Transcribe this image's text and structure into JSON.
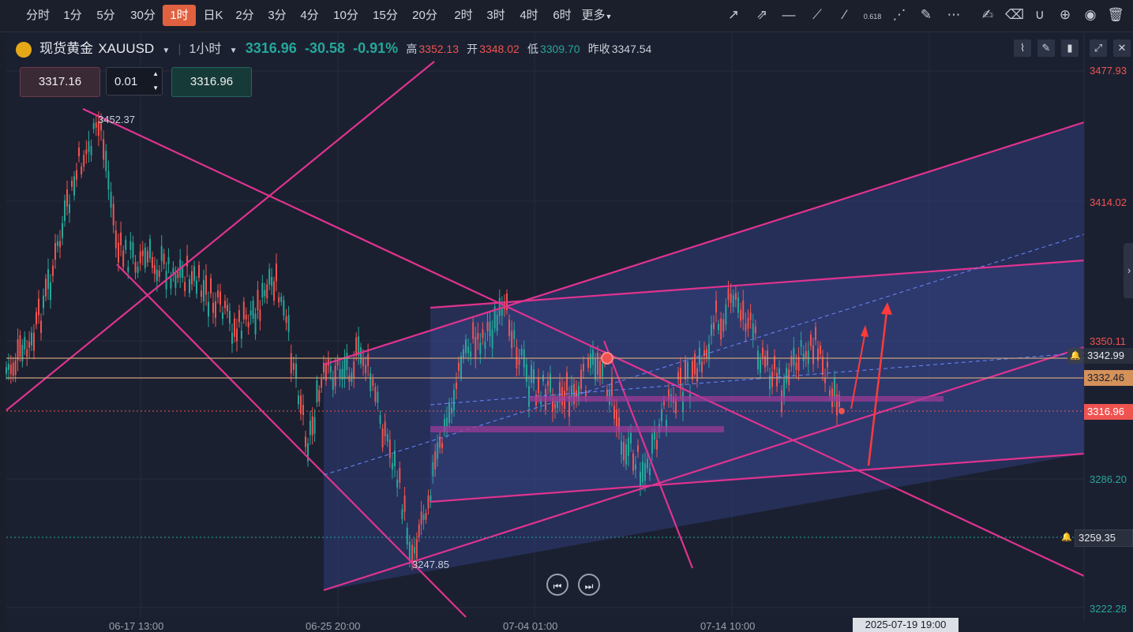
{
  "periods": [
    "分时",
    "1分",
    "5分",
    "30分",
    "1时",
    "日K",
    "2分",
    "3分",
    "4分",
    "10分",
    "15分",
    "20分",
    "2时",
    "3时",
    "4时",
    "6时",
    "更多"
  ],
  "active_period": "1时",
  "tools": [
    "arrow-line-icon",
    "dashed-arrow-icon",
    "horizontal-line-icon",
    "segment-icon",
    "ray-icon",
    "fibonacci-icon",
    "fan-icon",
    "pen-icon",
    "more-dots-icon",
    "edit-note-icon",
    "eraser-icon",
    "magnet-icon",
    "lock-icon",
    "eye-icon",
    "trash-icon"
  ],
  "fib_label": "0.618",
  "symbol": {
    "name": "现货黄金",
    "code": "XAUUSD",
    "interval": "1小时",
    "price": "3316.96",
    "change": "-30.58",
    "pct": "-0.91%",
    "high_label": "高",
    "high": "3352.13",
    "open_label": "开",
    "open": "3348.02",
    "low_label": "低",
    "low": "3309.70",
    "prev_label": "昨收",
    "prev": "3347.54"
  },
  "trade": {
    "sell": "3317.16",
    "lot": "0.01",
    "buy": "3316.96"
  },
  "y_axis": {
    "ticks": [
      "3477.93",
      "3414.02",
      "3350.11",
      "3286.20",
      "3222.28"
    ]
  },
  "price_tags": {
    "p1": "3342.99",
    "p2": "3332.46",
    "current": "3316.96",
    "alert": "3259.35"
  },
  "annotations": {
    "high": "3452.37",
    "low": "3247.85"
  },
  "x_axis": {
    "ticks": [
      "06-17 13:00",
      "06-25 20:00",
      "07-04 01:00",
      "07-14 10:00"
    ],
    "cursor": "2025-07-19 19:00"
  },
  "colors": {
    "up": "#26a69a",
    "down": "#ef5350",
    "line": "#e0338f",
    "channel": "#3a4a8a",
    "active": "#e0613f"
  }
}
